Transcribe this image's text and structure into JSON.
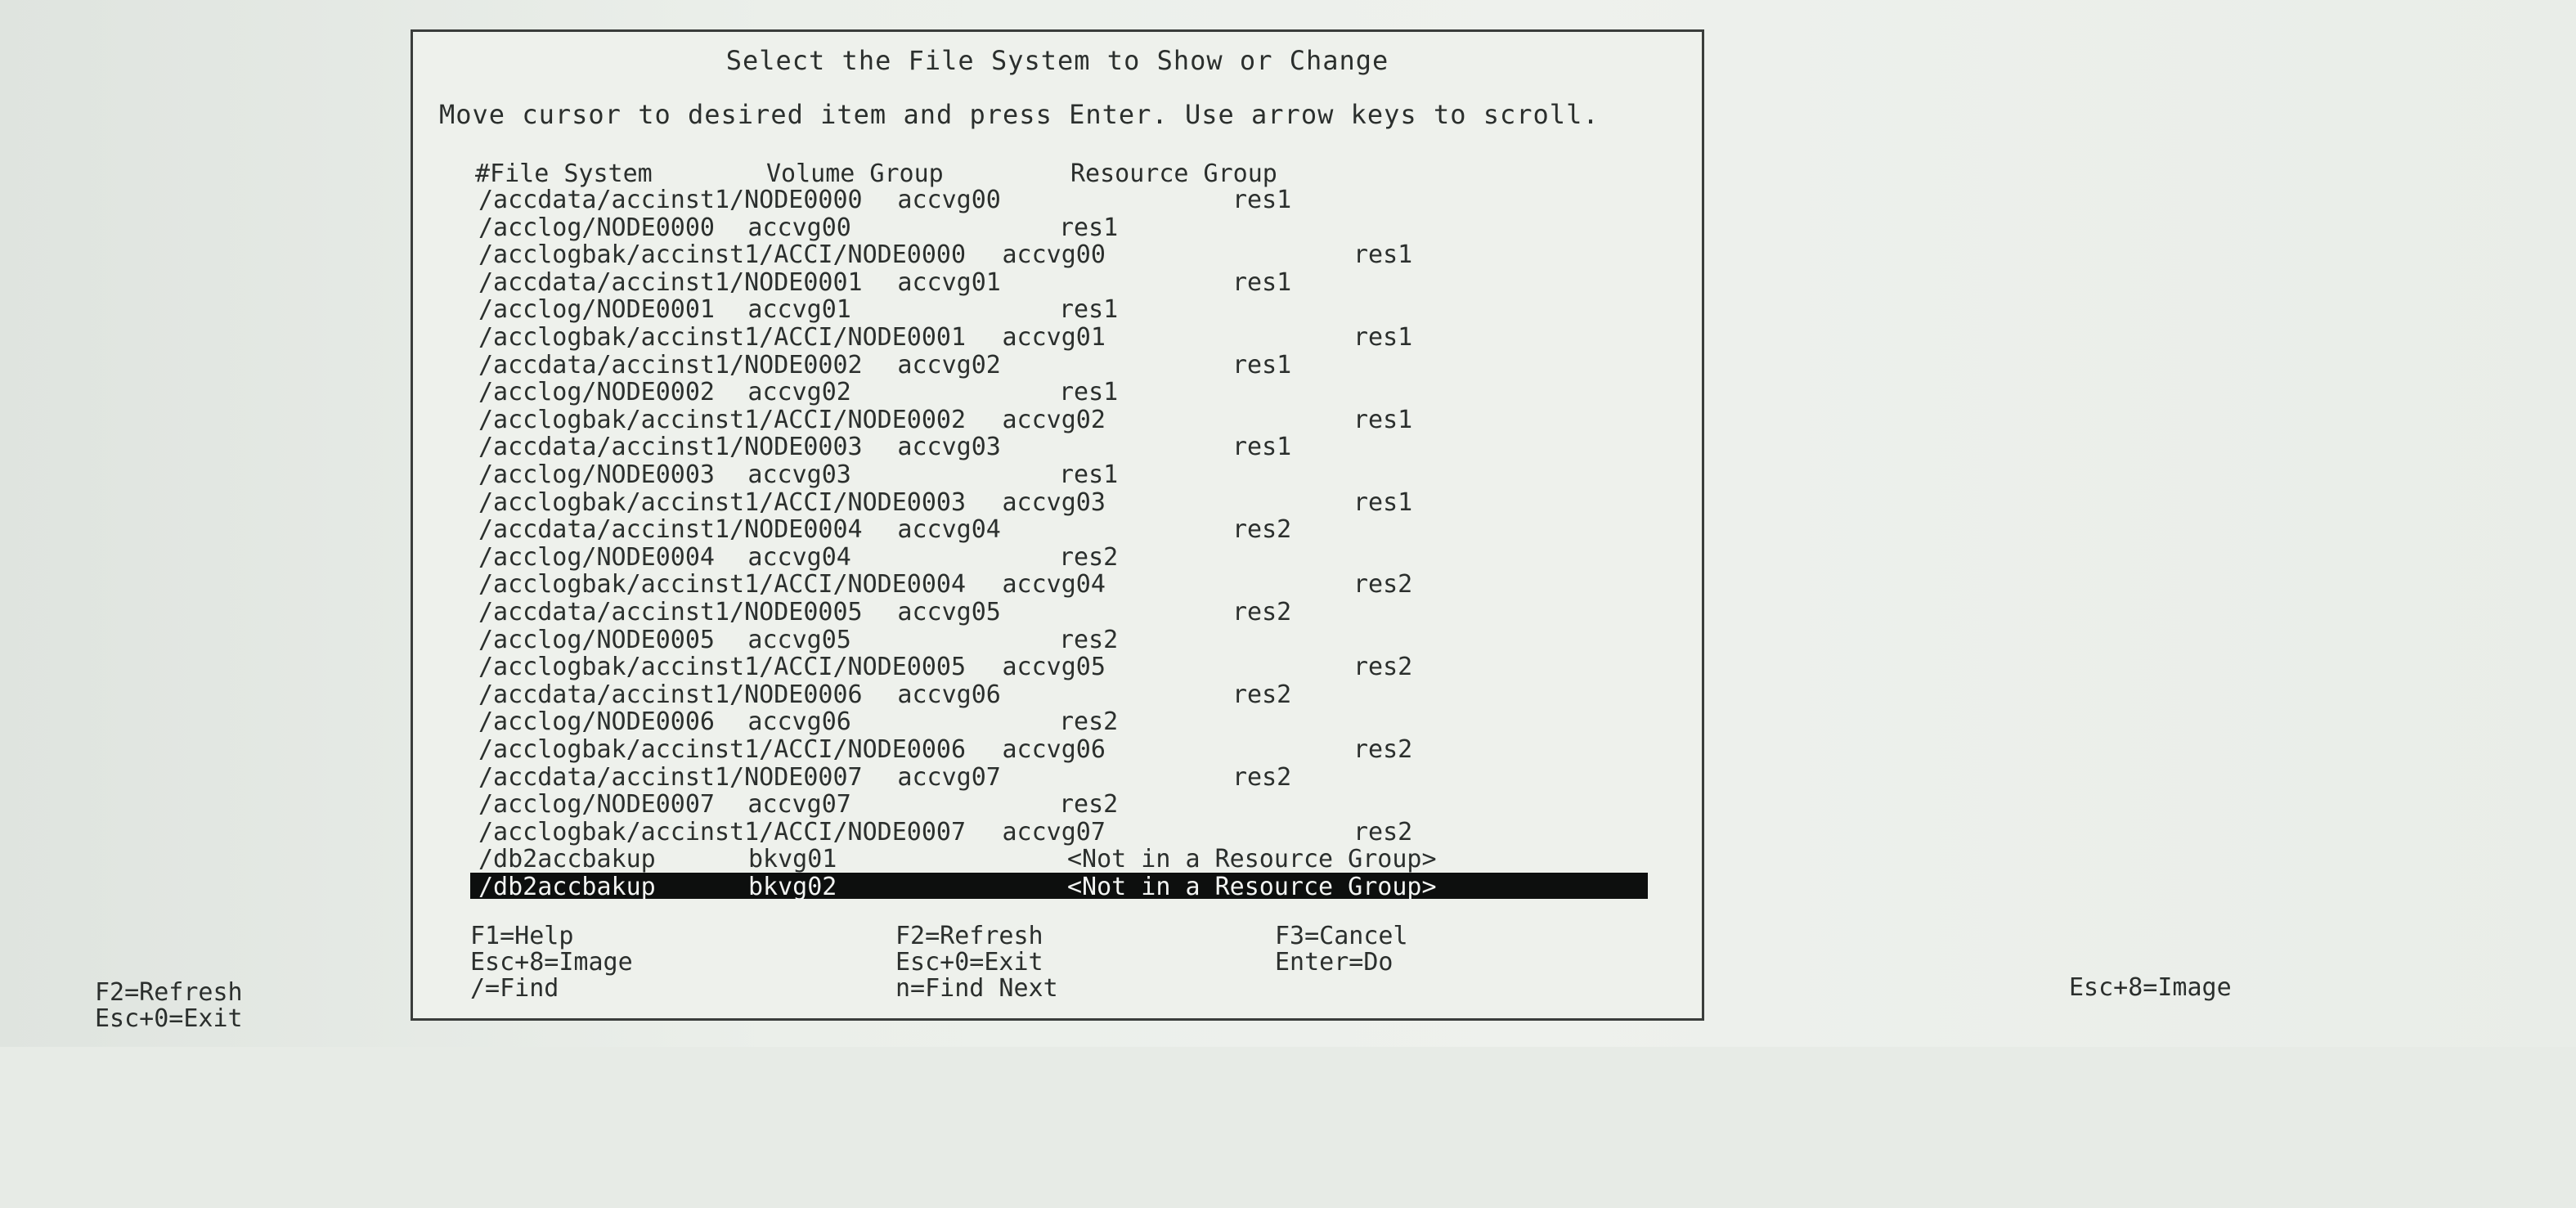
{
  "dialog": {
    "title": "Select the File System to Show or Change",
    "instruction": "Move cursor to desired item and press Enter. Use arrow keys to scroll.",
    "columns": {
      "file_system": "#File System",
      "volume_group": "Volume Group",
      "resource_group": "Resource Group"
    },
    "rows": [
      {
        "fs": "/accdata/accinst1/NODE0000",
        "vg": "accvg00",
        "rg": "res1"
      },
      {
        "fs": "/acclog/NODE0000",
        "vg": "accvg00",
        "rg": "res1"
      },
      {
        "fs": "/acclogbak/accinst1/ACCI/NODE0000",
        "vg": "accvg00",
        "rg": "res1"
      },
      {
        "fs": "/accdata/accinst1/NODE0001",
        "vg": "accvg01",
        "rg": "res1"
      },
      {
        "fs": "/acclog/NODE0001",
        "vg": "accvg01",
        "rg": "res1"
      },
      {
        "fs": "/acclogbak/accinst1/ACCI/NODE0001",
        "vg": "accvg01",
        "rg": "res1"
      },
      {
        "fs": "/accdata/accinst1/NODE0002",
        "vg": "accvg02",
        "rg": "res1"
      },
      {
        "fs": "/acclog/NODE0002",
        "vg": "accvg02",
        "rg": "res1"
      },
      {
        "fs": "/acclogbak/accinst1/ACCI/NODE0002",
        "vg": "accvg02",
        "rg": "res1"
      },
      {
        "fs": "/accdata/accinst1/NODE0003",
        "vg": "accvg03",
        "rg": "res1"
      },
      {
        "fs": "/acclog/NODE0003",
        "vg": "accvg03",
        "rg": "res1"
      },
      {
        "fs": "/acclogbak/accinst1/ACCI/NODE0003",
        "vg": "accvg03",
        "rg": "res1"
      },
      {
        "fs": "/accdata/accinst1/NODE0004",
        "vg": "accvg04",
        "rg": "res2"
      },
      {
        "fs": "/acclog/NODE0004",
        "vg": "accvg04",
        "rg": "res2"
      },
      {
        "fs": "/acclogbak/accinst1/ACCI/NODE0004",
        "vg": "accvg04",
        "rg": "res2"
      },
      {
        "fs": "/accdata/accinst1/NODE0005",
        "vg": "accvg05",
        "rg": "res2"
      },
      {
        "fs": "/acclog/NODE0005",
        "vg": "accvg05",
        "rg": "res2"
      },
      {
        "fs": "/acclogbak/accinst1/ACCI/NODE0005",
        "vg": "accvg05",
        "rg": "res2"
      },
      {
        "fs": "/accdata/accinst1/NODE0006",
        "vg": "accvg06",
        "rg": "res2"
      },
      {
        "fs": "/acclog/NODE0006",
        "vg": "accvg06",
        "rg": "res2"
      },
      {
        "fs": "/acclogbak/accinst1/ACCI/NODE0006",
        "vg": "accvg06",
        "rg": "res2"
      },
      {
        "fs": "/accdata/accinst1/NODE0007",
        "vg": "accvg07",
        "rg": "res2"
      },
      {
        "fs": "/acclog/NODE0007",
        "vg": "accvg07",
        "rg": "res2"
      },
      {
        "fs": "/acclogbak/accinst1/ACCI/NODE0007",
        "vg": "accvg07",
        "rg": "res2"
      },
      {
        "fs": "/db2accbakup",
        "vg": "bkvg01",
        "rg": "<Not in a Resource Group>"
      },
      {
        "fs": "/db2accbakup",
        "vg": "bkvg02",
        "rg": "<Not in a Resource Group>",
        "selected": true
      }
    ],
    "function_keys": {
      "help": "F1=Help",
      "refresh": "F2=Refresh",
      "cancel": "F3=Cancel",
      "image": "Esc+8=Image",
      "exit": "Esc+0=Exit",
      "do": "Enter=Do",
      "find": "/=Find",
      "find_next": "n=Find Next"
    }
  },
  "background_screen": {
    "refresh": "F2=Refresh",
    "exit": "Esc+0=Exit",
    "image": "Esc+8=Image"
  }
}
